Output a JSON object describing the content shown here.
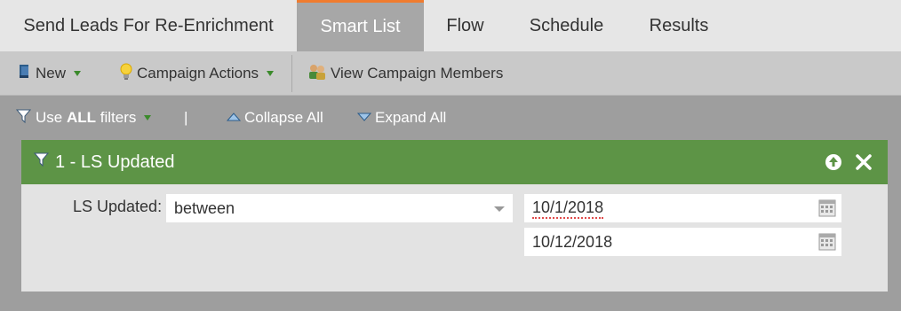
{
  "tabs": [
    {
      "label": "Send Leads For Re-Enrichment"
    },
    {
      "label": "Smart List"
    },
    {
      "label": "Flow"
    },
    {
      "label": "Schedule"
    },
    {
      "label": "Results"
    }
  ],
  "toolbar": {
    "new_label": "New",
    "campaign_actions_label": "Campaign Actions",
    "view_members_label": "View Campaign Members"
  },
  "filterbar": {
    "use_prefix": "Use",
    "use_strong": "ALL",
    "use_suffix": "filters",
    "separator": "|",
    "collapse_label": "Collapse All",
    "expand_label": "Expand All"
  },
  "filter": {
    "title": "1 - LS Updated",
    "field_label": "LS Updated:",
    "operator": "between",
    "start_date": "10/1/2018",
    "end_date": "10/12/2018"
  },
  "colors": {
    "accent": "#f07c2f",
    "header_green": "#5d9446",
    "caret_green": "#3b8a2b"
  }
}
